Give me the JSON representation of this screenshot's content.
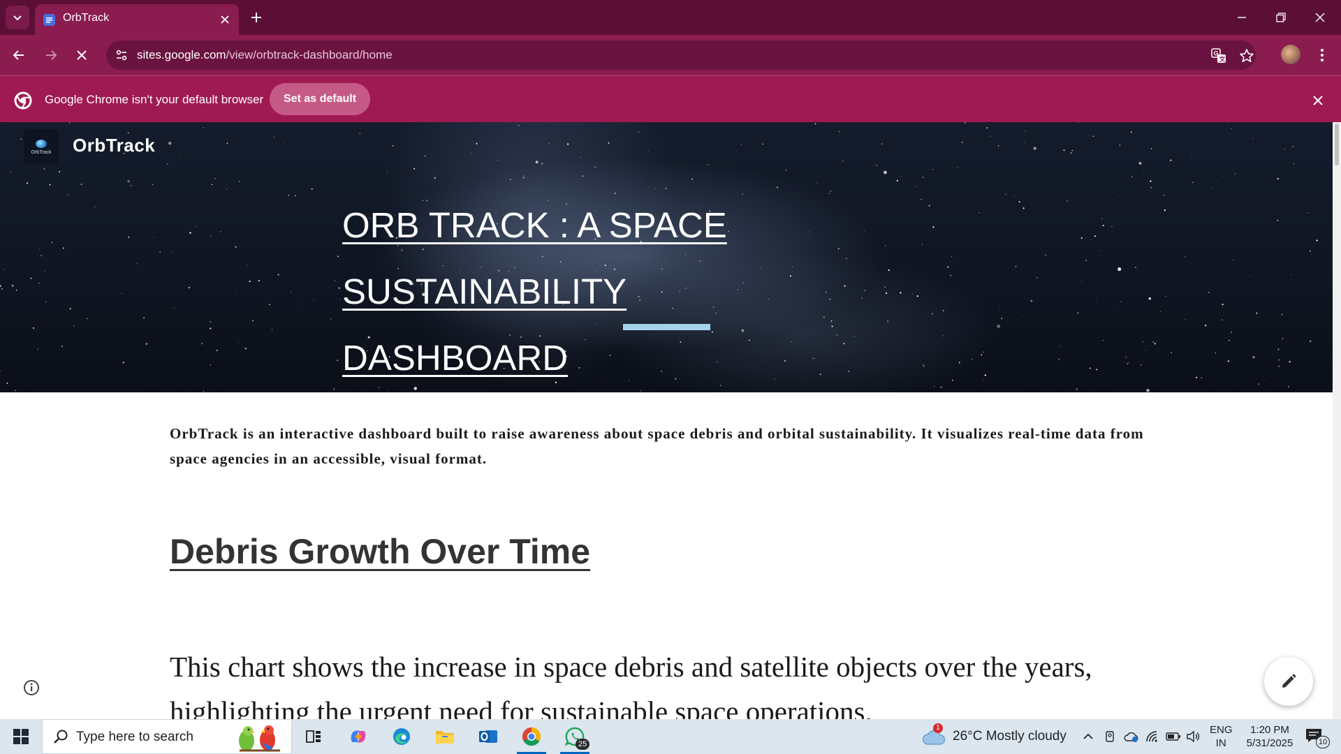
{
  "browser": {
    "tab_title": "OrbTrack",
    "url_host": "sites.google.com",
    "url_path": "/view/orbtrack-dashboard/home",
    "infobar_text": "Google Chrome isn't your default browser",
    "set_default_label": "Set as default"
  },
  "site": {
    "logo_text": "OrbTrack",
    "name": "OrbTrack",
    "hero_line1": "ORB TRACK : A SPACE SUSTAINABILITY",
    "hero_line2": "DASHBOARD",
    "intro": "OrbTrack is an interactive dashboard built to raise awareness about space debris and orbital sustainability. It visualizes real-time data from space agencies in an accessible, visual format.",
    "section_heading": "Debris Growth Over Time",
    "section_desc": "This chart shows the increase in space debris and satellite objects over the years, highlighting the urgent need for sustainable space operations."
  },
  "taskbar": {
    "search_placeholder": "Type here to search",
    "whatsapp_badge": "25",
    "weather_alert": "1",
    "weather_text": "26°C  Mostly cloudy",
    "lang_line1": "ENG",
    "lang_line2": "IN",
    "time": "1:20 PM",
    "date": "5/31/2025",
    "notification_count": "10"
  },
  "colors": {
    "tab_strip": "#5b0f35",
    "toolbar": "#8a1c50",
    "infobar": "#9f1a52",
    "hero_accent": "#a5d3ea"
  }
}
